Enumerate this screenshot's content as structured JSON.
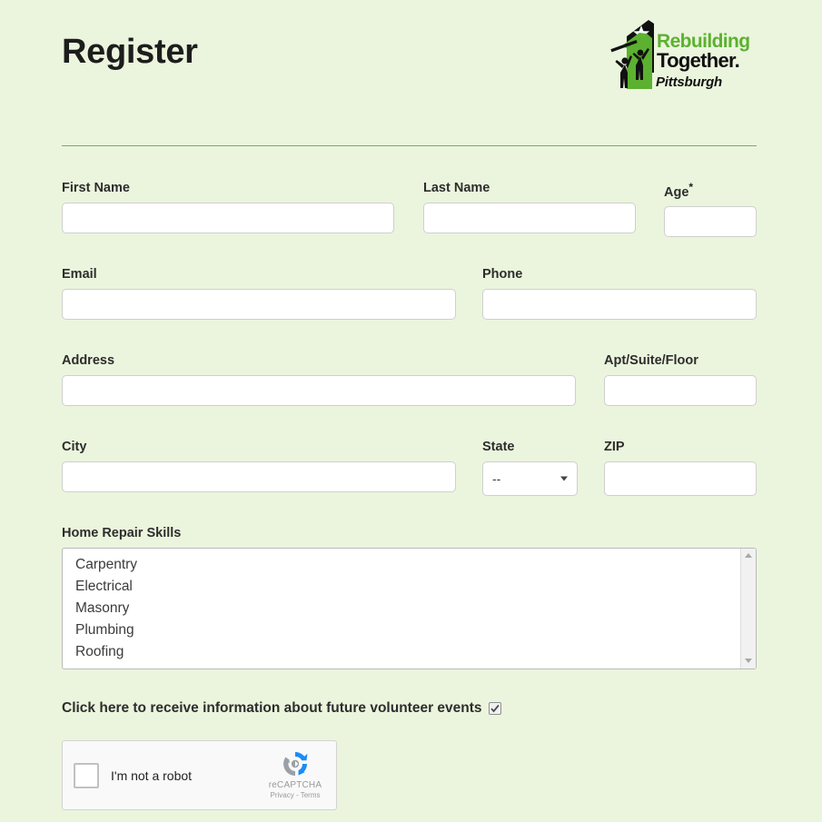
{
  "header": {
    "title": "Register"
  },
  "logo": {
    "line1": "Rebuilding",
    "line2": "Together.",
    "line3": "Pittsburgh",
    "green": "#5cb130",
    "black": "#111111"
  },
  "form": {
    "first_name": {
      "label": "First Name",
      "value": "",
      "placeholder": ""
    },
    "last_name": {
      "label": "Last Name",
      "value": "",
      "placeholder": ""
    },
    "age": {
      "label": "Age",
      "required_marker": "*",
      "value": "",
      "placeholder": ""
    },
    "email": {
      "label": "Email",
      "value": "",
      "placeholder": ""
    },
    "phone": {
      "label": "Phone",
      "value": "",
      "placeholder": ""
    },
    "address": {
      "label": "Address",
      "value": "",
      "placeholder": ""
    },
    "apt": {
      "label": "Apt/Suite/Floor",
      "value": "",
      "placeholder": ""
    },
    "city": {
      "label": "City",
      "value": "",
      "placeholder": ""
    },
    "state": {
      "label": "State",
      "selected": "--"
    },
    "zip": {
      "label": "ZIP",
      "value": "",
      "placeholder": ""
    },
    "skills": {
      "label": "Home Repair Skills",
      "options": [
        "Carpentry",
        "Electrical",
        "Masonry",
        "Plumbing",
        "Roofing"
      ]
    },
    "newsletter": {
      "label": "Click here to receive information about future volunteer events",
      "checked": true
    }
  },
  "recaptcha": {
    "label": "I'm not a robot",
    "brand": "reCAPTCHA",
    "terms": "Privacy - Terms",
    "checked": false
  }
}
